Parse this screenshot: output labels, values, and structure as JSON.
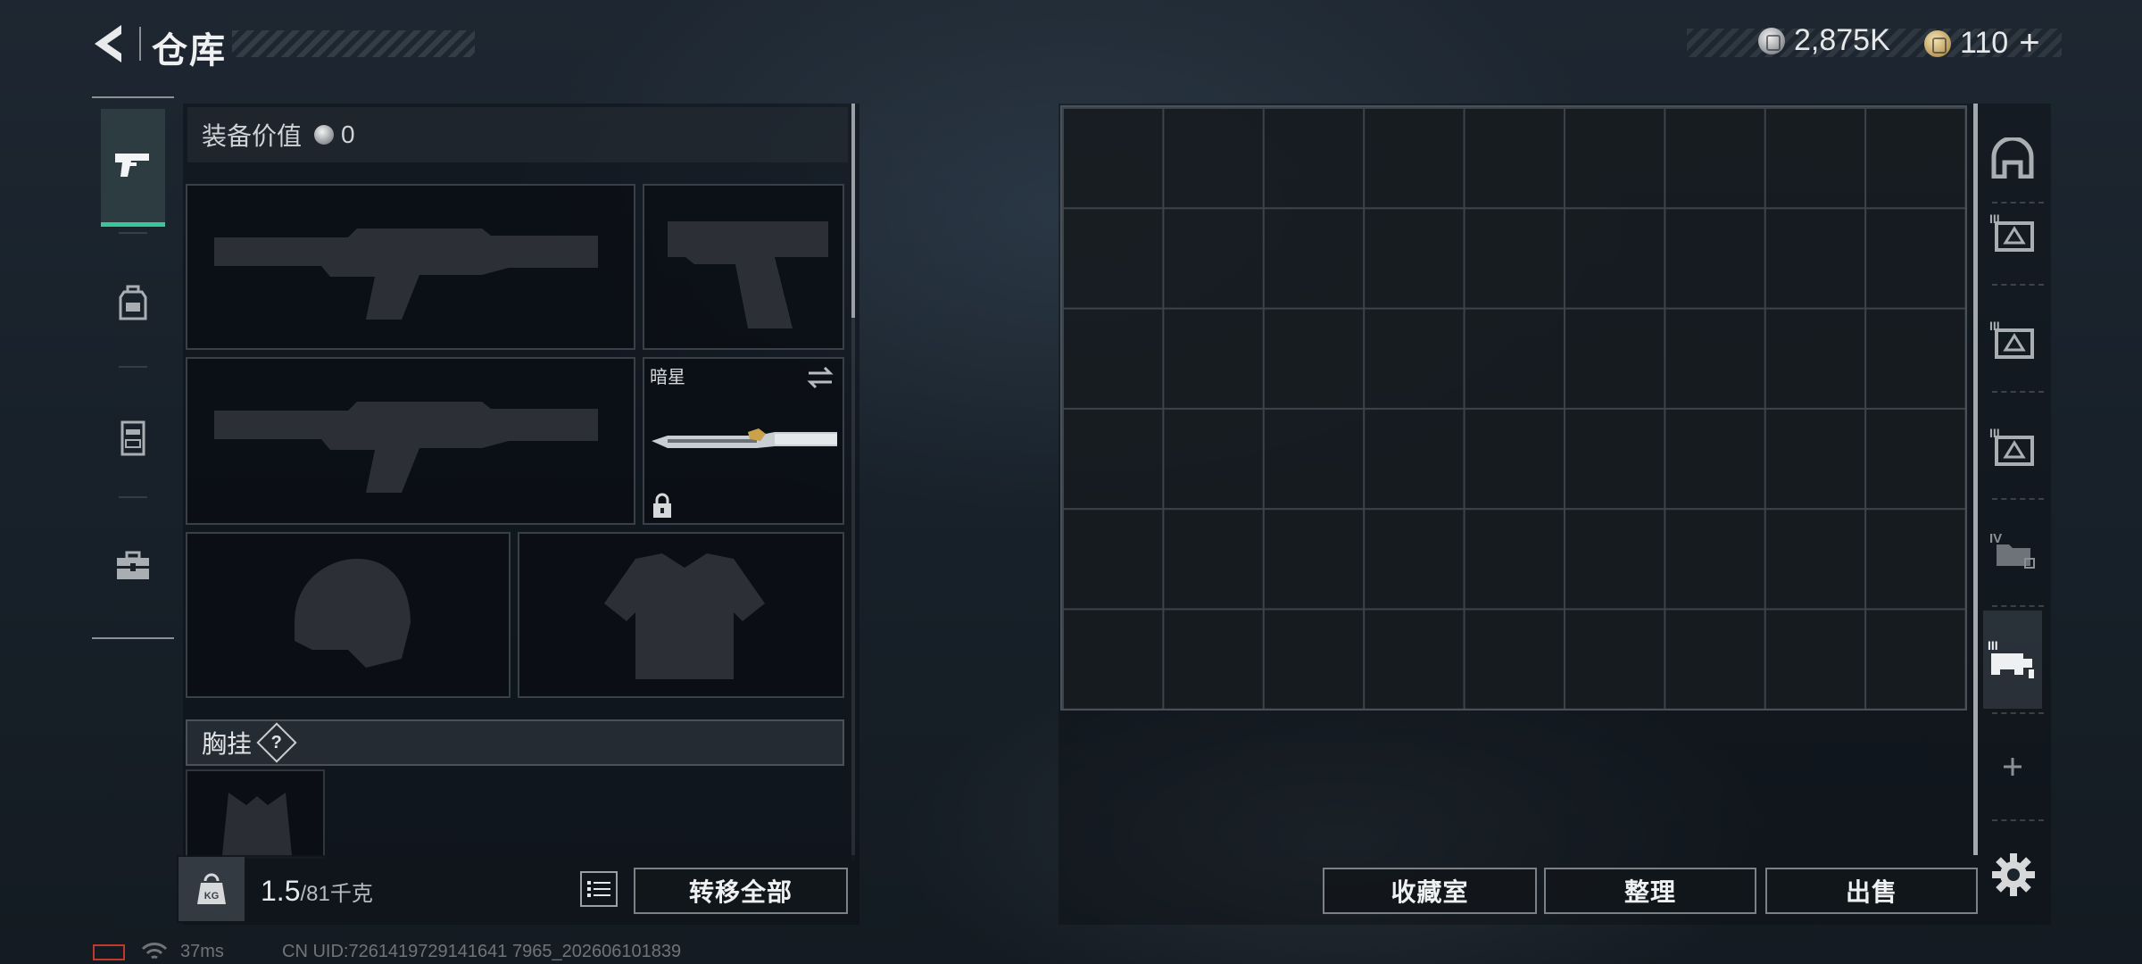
{
  "header": {
    "title": "仓库",
    "back_icon": "back-arrow-icon",
    "currencies": [
      {
        "icon": "silver-coin-icon",
        "value": "2,875K"
      },
      {
        "icon": "gold-coin-icon",
        "value": "110"
      }
    ],
    "plus_label": "+"
  },
  "left_nav": {
    "items": [
      {
        "name": "weapons",
        "icon": "pistol-icon",
        "active": true
      },
      {
        "name": "armor",
        "icon": "backpack-icon",
        "active": false
      },
      {
        "name": "rig",
        "icon": "vest-icon",
        "active": false
      },
      {
        "name": "toolbox",
        "icon": "toolbox-icon",
        "active": false
      }
    ]
  },
  "equipment": {
    "value_label": "装备价值",
    "value_amount": "0",
    "slots": [
      {
        "name": "primary-weapon-slot",
        "icon": "rifle-silhouette-icon"
      },
      {
        "name": "pistol-slot",
        "icon": "pistol-silhouette-icon"
      },
      {
        "name": "secondary-weapon-slot",
        "icon": "rifle-silhouette-icon"
      },
      {
        "name": "melee-slot",
        "label": "暗星",
        "icon": "knife-icon",
        "locked": true
      },
      {
        "name": "helmet-slot",
        "icon": "helmet-silhouette-icon"
      },
      {
        "name": "body-armor-slot",
        "icon": "armor-silhouette-icon"
      }
    ],
    "chest_rig_label": "胸挂",
    "help_label": "?"
  },
  "bottom_bar": {
    "weight_current": "1.5",
    "weight_max": "/81千克",
    "transfer_all_label": "转移全部"
  },
  "storage": {
    "columns": 9,
    "rows": 6
  },
  "right_tabs": [
    {
      "icon": "container-arch-icon"
    },
    {
      "icon": "case-tier-3-icon"
    },
    {
      "icon": "case-tier-3-icon"
    },
    {
      "icon": "case-tier-3-icon"
    },
    {
      "icon": "folder-tier-4-icon"
    },
    {
      "icon": "rack-tier-3-icon"
    },
    {
      "icon": "add-container-icon"
    }
  ],
  "actions": {
    "collection_label": "收藏室",
    "organize_label": "整理",
    "sell_label": "出售"
  },
  "status_bar": {
    "ping": "37ms",
    "uid": "CN UID:7261419729141641 7965_202606101839"
  },
  "colors": {
    "accent": "#39c79a",
    "lock_battery": "#c0392b"
  }
}
